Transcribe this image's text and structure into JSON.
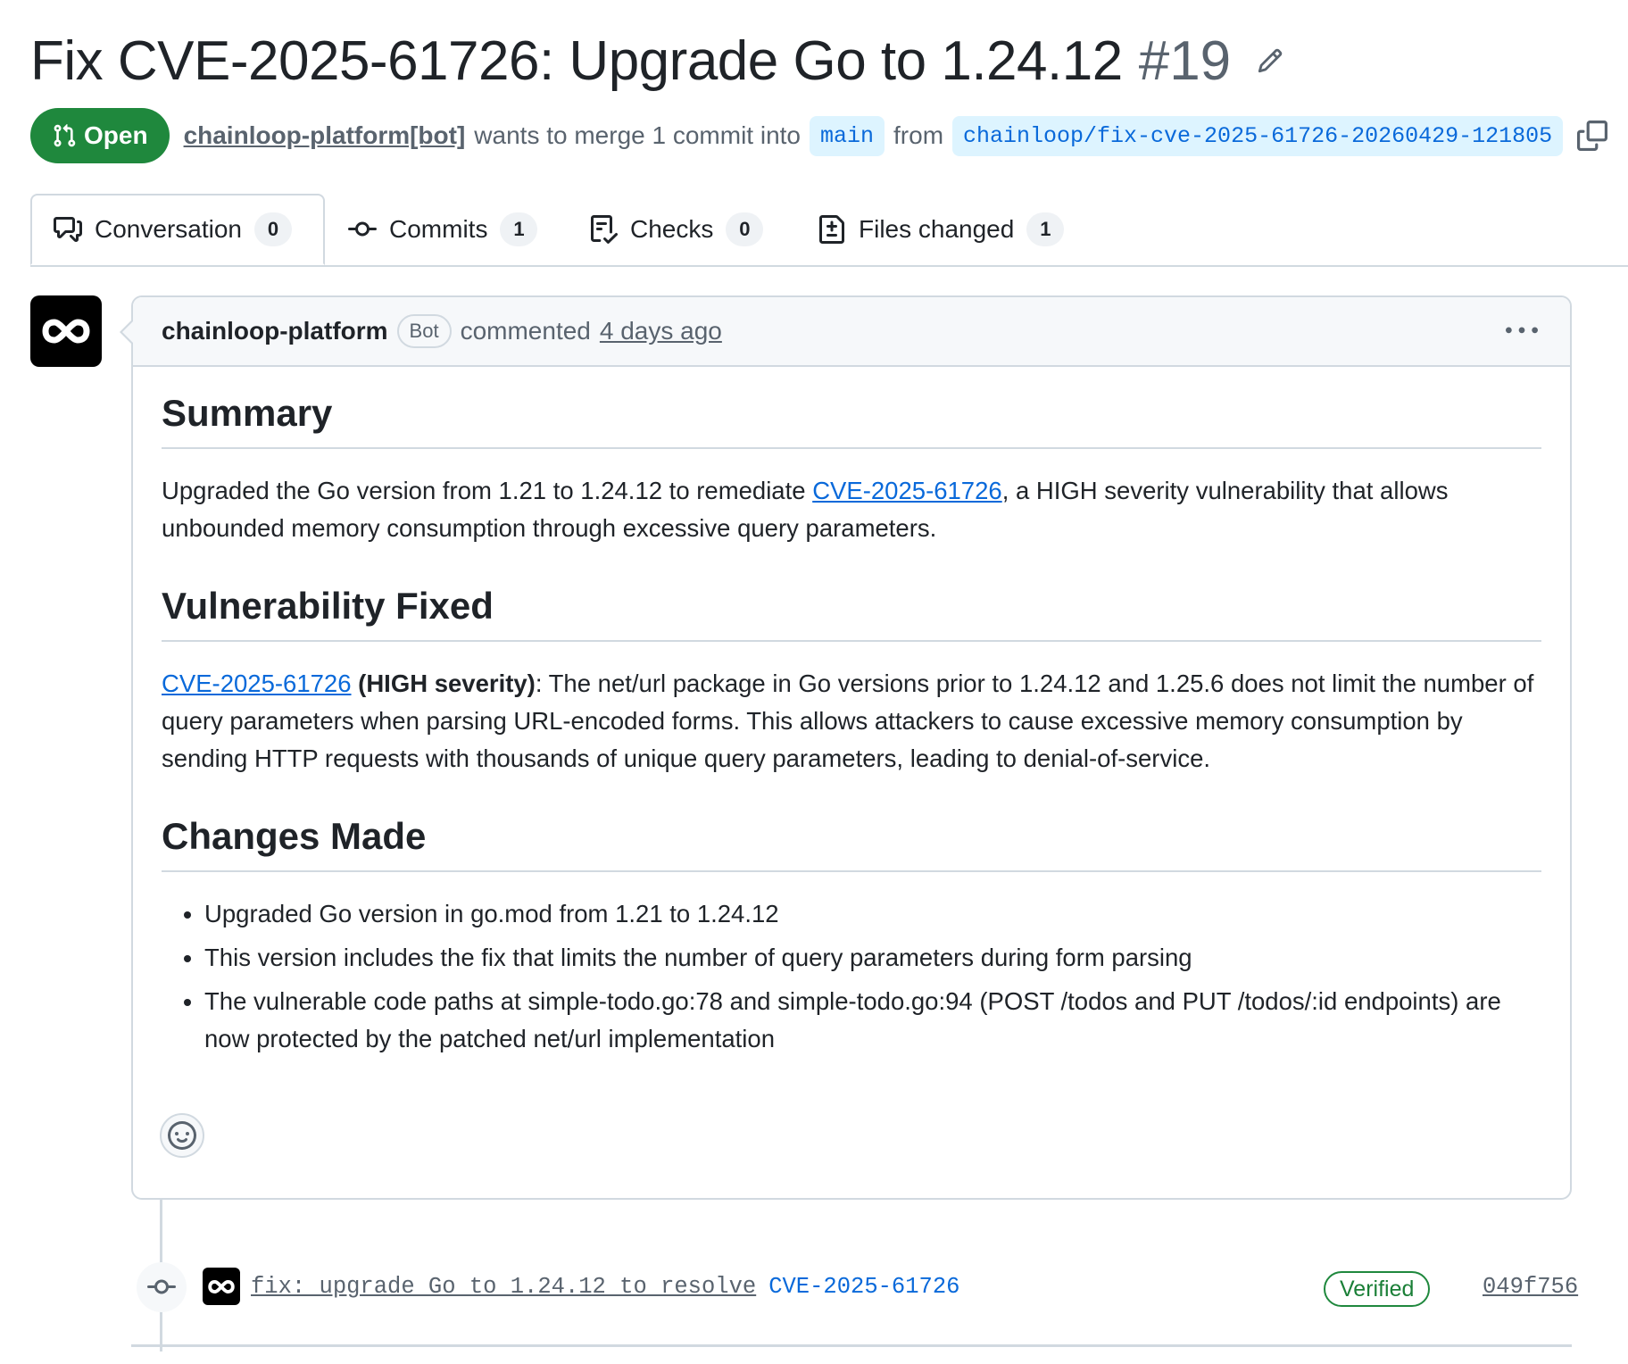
{
  "pr": {
    "title": "Fix CVE-2025-61726: Upgrade Go to 1.24.12",
    "number": "#19",
    "state": "Open",
    "author": "chainloop-platform[bot]",
    "merge_text": "wants to merge 1 commit into",
    "base_branch": "main",
    "from_text": "from",
    "head_branch": "chainloop/fix-cve-2025-61726-20260429-121805"
  },
  "tabs": [
    {
      "label": "Conversation",
      "count": "0",
      "icon": "comment-discussion-icon"
    },
    {
      "label": "Commits",
      "count": "1",
      "icon": "git-commit-icon"
    },
    {
      "label": "Checks",
      "count": "0",
      "icon": "checklist-icon"
    },
    {
      "label": "Files changed",
      "count": "1",
      "icon": "file-diff-icon"
    }
  ],
  "comment": {
    "author": "chainloop-platform",
    "bot_label": "Bot",
    "action": "commented",
    "time": "4 days ago",
    "sections": {
      "summary": {
        "heading": "Summary",
        "text_before": "Upgraded the Go version from 1.21 to 1.24.12 to remediate ",
        "link": "CVE-2025-61726",
        "text_after": ", a HIGH severity vulnerability that allows unbounded memory consumption through excessive query parameters."
      },
      "vulnerability": {
        "heading": "Vulnerability Fixed",
        "link": "CVE-2025-61726",
        "bold": " (HIGH severity)",
        "text": ": The net/url package in Go versions prior to 1.24.12 and 1.25.6 does not limit the number of query parameters when parsing URL-encoded forms. This allows attackers to cause excessive memory consumption by sending HTTP requests with thousands of unique query parameters, leading to denial-of-service."
      },
      "changes": {
        "heading": "Changes Made",
        "items": [
          "Upgraded Go version in go.mod from 1.21 to 1.24.12",
          "This version includes the fix that limits the number of query parameters during form parsing",
          "The vulnerable code paths at simple-todo.go:78 and simple-todo.go:94 (POST /todos and PUT /todos/:id endpoints) are now protected by the patched net/url implementation"
        ]
      }
    }
  },
  "commit": {
    "message": "fix: upgrade Go to 1.24.12 to resolve",
    "cve": "CVE-2025-61726",
    "verified": "Verified",
    "sha": "049f756"
  },
  "colors": {
    "open_green": "#1f883d",
    "link_blue": "#0969da",
    "branch_bg": "#ddf4ff",
    "border": "#d1d9e0",
    "muted": "#59636e"
  }
}
